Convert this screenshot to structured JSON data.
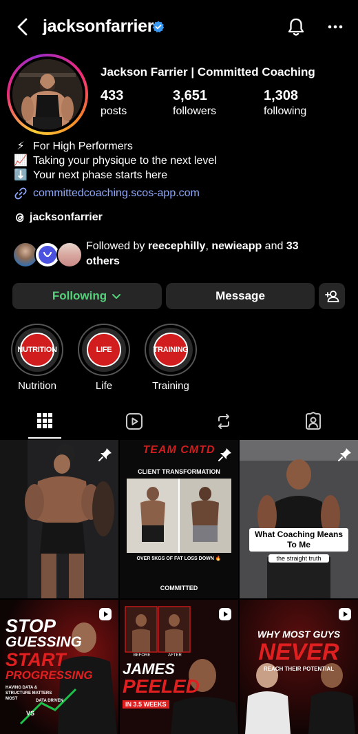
{
  "header": {
    "username": "jacksonfarrier",
    "icons": [
      "back-icon",
      "verified-icon",
      "bell-icon",
      "more-icon"
    ]
  },
  "profile": {
    "display_name": "Jackson Farrier | Committed Coaching",
    "stats": {
      "posts": {
        "value": "433",
        "label": "posts"
      },
      "followers": {
        "value": "3,651",
        "label": "followers"
      },
      "following": {
        "value": "1,308",
        "label": "following"
      }
    },
    "bio": [
      {
        "emoji": "⚡",
        "text": "For High Performers"
      },
      {
        "emoji": "📈",
        "text": "Taking your physique to the next level"
      },
      {
        "emoji": "⬇️",
        "text": "Your next phase starts here"
      }
    ],
    "link": "committedcoaching.scos-app.com",
    "threads_handle": "jacksonfarrier",
    "followed_by": {
      "prefix": "Followed by ",
      "user1": "reecephilly",
      "sep": ", ",
      "user2": "newieapp",
      "and": " and ",
      "count": "33",
      "others": "others"
    }
  },
  "actions": {
    "following_label": "Following",
    "message_label": "Message"
  },
  "highlights": [
    {
      "badge": "NUTRITION",
      "label": "Nutrition"
    },
    {
      "badge": "LIFE",
      "label": "Life"
    },
    {
      "badge": "TRAINING",
      "label": "Training"
    }
  ],
  "tabs": [
    "grid",
    "reels",
    "reposts",
    "tagged"
  ],
  "posts": [
    {
      "type": "pinned",
      "text": ""
    },
    {
      "type": "pinned",
      "brand": "TEAM CMTD",
      "title": "CLIENT TRANSFORMATION",
      "caption": "OVER 5KGS OF FAT LOSS DOWN 🔥",
      "footer": "COMMITTED"
    },
    {
      "type": "pinned",
      "title": "What Coaching Means To Me",
      "subtitle": "the straight truth"
    },
    {
      "type": "reel",
      "line1": "STOP",
      "line2": "GUESSING",
      "line3": "START",
      "line4": "PROGRESSING",
      "caption": "HAVING DATA & STRUCTURE MATTERS MOST",
      "vs": "VS",
      "tag": "DATA DRIVEN"
    },
    {
      "type": "reel",
      "before": "BEFORE",
      "after": "AFTER",
      "name": "JAMES",
      "word": "PEELED",
      "weeks": "IN 3.5 WEEKS"
    },
    {
      "type": "reel",
      "line1": "WHY MOST GUYS",
      "line2": "NEVER",
      "line3": "REACH THEIR POTENTIAL"
    }
  ],
  "colors": {
    "background": "#000000",
    "button": "#262626",
    "following_green": "#54d17a",
    "link_blue": "#8ea8ff",
    "highlight_red": "#d11d1d",
    "verified_blue": "#3897f0"
  }
}
